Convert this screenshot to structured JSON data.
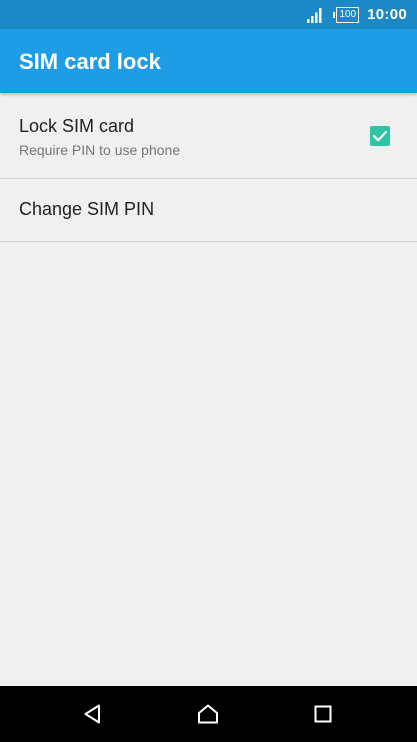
{
  "status_bar": {
    "signal_icon": "signal-icon",
    "battery_level": "100",
    "time": "10:00"
  },
  "app_bar": {
    "title": "SIM card lock"
  },
  "settings": {
    "lock_sim_card": {
      "title": "Lock SIM card",
      "subtitle": "Require PIN to use phone",
      "checked": true
    },
    "change_sim_pin": {
      "title": "Change SIM PIN"
    }
  },
  "navigation": {
    "back_icon": "back-triangle-icon",
    "home_icon": "home-icon",
    "recents_icon": "recents-square-icon"
  },
  "colors": {
    "status_bar": "#1b88c7",
    "app_bar": "#1e9de6",
    "checkbox": "#2ec4a6",
    "background": "#f0f0f0"
  }
}
